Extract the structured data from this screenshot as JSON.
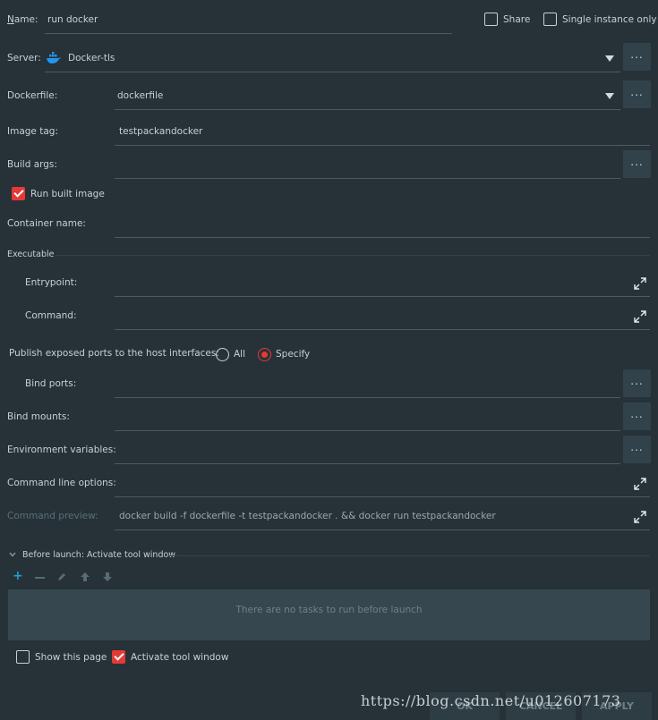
{
  "name": {
    "label": "Name:",
    "value": "run docker"
  },
  "share": {
    "label": "Share",
    "checked": false
  },
  "single_instance": {
    "label": "Single instance only",
    "checked": false
  },
  "server": {
    "label": "Server:",
    "value": "Docker-tls",
    "icon": "docker-whale-icon"
  },
  "dockerfile": {
    "label": "Dockerfile:",
    "value": "dockerfile"
  },
  "image_tag": {
    "label": "Image tag:",
    "value": "testpackandocker"
  },
  "build_args": {
    "label": "Build args:",
    "value": ""
  },
  "run_built_image": {
    "label": "Run built image",
    "checked": true
  },
  "container_name": {
    "label": "Container name:",
    "value": ""
  },
  "executable": {
    "section_label": "Executable",
    "entrypoint_label": "Entrypoint:",
    "entrypoint_value": "",
    "command_label": "Command:",
    "command_value": ""
  },
  "publish_ports": {
    "label": "Publish exposed ports to the host interfaces:",
    "options": [
      "All",
      "Specify"
    ],
    "selected": "Specify"
  },
  "bind_ports": {
    "label": "Bind ports:",
    "value": ""
  },
  "bind_mounts": {
    "label": "Bind mounts:",
    "value": ""
  },
  "env_vars": {
    "label": "Environment variables:",
    "value": ""
  },
  "cmd_options": {
    "label": "Command line options:",
    "value": ""
  },
  "cmd_preview": {
    "label": "Command preview:",
    "value": "docker build -f dockerfile -t testpackandocker . && docker run testpackandocker"
  },
  "before_launch": {
    "title": "Before launch: Activate tool window",
    "empty_text": "There are no tasks to run before launch",
    "toolbar": [
      "add-icon",
      "remove-icon",
      "edit-icon",
      "move-up-icon",
      "move-down-icon"
    ]
  },
  "show_this_page": {
    "label": "Show this page",
    "checked": false
  },
  "activate_tool_window": {
    "label": "Activate tool window",
    "checked": true
  },
  "dots_label": "...",
  "buttons": {
    "ok": "OK",
    "cancel": "CANCEL",
    "apply": "APPLY"
  },
  "watermark": "https://blog.csdn.net/u012607173",
  "colors": {
    "background": "#263238",
    "accent": "#e53935",
    "link_blue": "#1e9ed8"
  }
}
